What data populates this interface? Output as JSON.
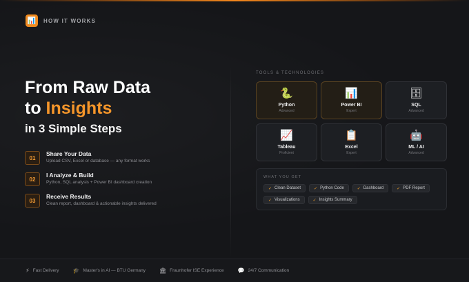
{
  "header": {
    "logo_icon": "chart-icon",
    "title": "HOW IT WORKS"
  },
  "hero": {
    "line1": "From Raw Data",
    "line2_prefix": "to ",
    "line2_accent": "Insights",
    "subtitle": "in 3 Simple Steps",
    "accent_color": "#f6962a"
  },
  "steps": [
    {
      "number": "01",
      "title": "Share Your Data",
      "description": "Upload CSV, Excel or database — any format works"
    },
    {
      "number": "02",
      "title": "I Analyze & Build",
      "description": "Python, SQL analysis + Power BI dashboard creation"
    },
    {
      "number": "03",
      "title": "Receive Results",
      "description": "Clean report, dashboard & actionable insights delivered"
    }
  ],
  "tools": {
    "label": "TOOLS & TECHNOLOGIES",
    "items": [
      {
        "icon": "🐍",
        "icon_name": "python-snake-icon",
        "name": "Python",
        "level": "Advanced"
      },
      {
        "icon": "📊",
        "icon_name": "bar-chart-icon",
        "name": "Power BI",
        "level": "Expert"
      },
      {
        "icon": "🗄",
        "icon_name": "database-cabinet-icon",
        "name": "SQL",
        "level": "Advanced"
      },
      {
        "icon": "📈",
        "icon_name": "trend-chart-icon",
        "name": "Tableau",
        "level": "Proficient"
      },
      {
        "icon": "📋",
        "icon_name": "clipboard-icon",
        "name": "Excel",
        "level": "Expert"
      },
      {
        "icon": "🤖",
        "icon_name": "robot-icon",
        "name": "ML / AI",
        "level": "Advanced"
      }
    ]
  },
  "what_you_get": {
    "label": "WHAT YOU GET",
    "items": [
      "Clean Dataset",
      "Python Code",
      "Dashboard",
      "PDF Report",
      "Visualizations",
      "Insights Summary"
    ],
    "check": "✓"
  },
  "footer": [
    {
      "icon": "⚡",
      "icon_name": "lightning-icon",
      "text": "Fast Delivery"
    },
    {
      "icon": "🎓",
      "icon_name": "graduation-cap-icon",
      "text": "Master's in AI — BTU Germany"
    },
    {
      "icon": "🏛",
      "icon_name": "institution-icon",
      "text": "Fraunhofer ISE Experience"
    },
    {
      "icon": "💬",
      "icon_name": "chat-bubble-icon",
      "text": "24/7 Communication"
    }
  ]
}
